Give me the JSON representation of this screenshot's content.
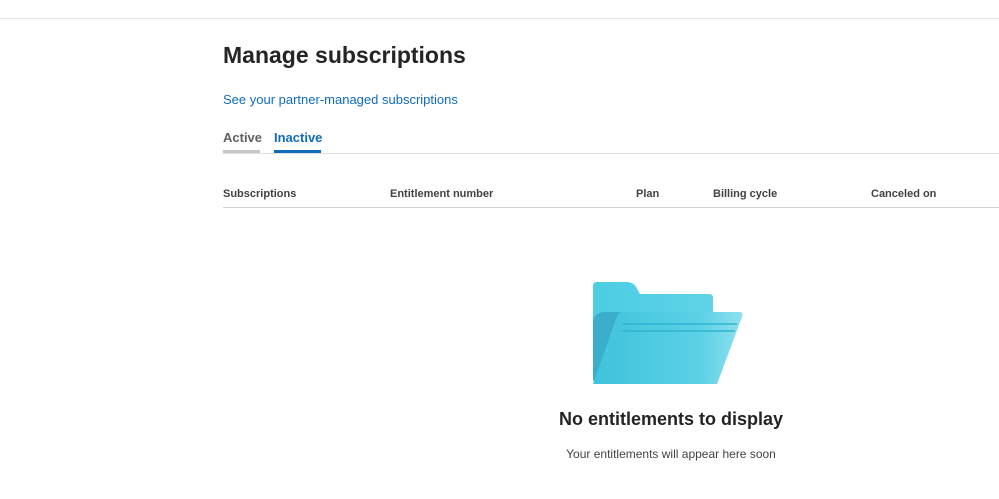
{
  "header": {
    "title": "Manage subscriptions",
    "partner_link": "See your partner-managed subscriptions"
  },
  "tabs": [
    {
      "label": "Active",
      "selected": false
    },
    {
      "label": "Inactive",
      "selected": true
    }
  ],
  "table": {
    "columns": [
      "Subscriptions",
      "Entitlement number",
      "Plan",
      "Billing cycle",
      "Canceled on"
    ],
    "rows": []
  },
  "empty_state": {
    "icon": "folder-icon",
    "title": "No entitlements to display",
    "subtitle": "Your entitlements will appear here soon"
  },
  "colors": {
    "accent": "#0f6cbd",
    "text": "#242424",
    "folder_light": "#7fdced",
    "folder_mid": "#4cc9e0",
    "folder_dark": "#3aaecb"
  }
}
